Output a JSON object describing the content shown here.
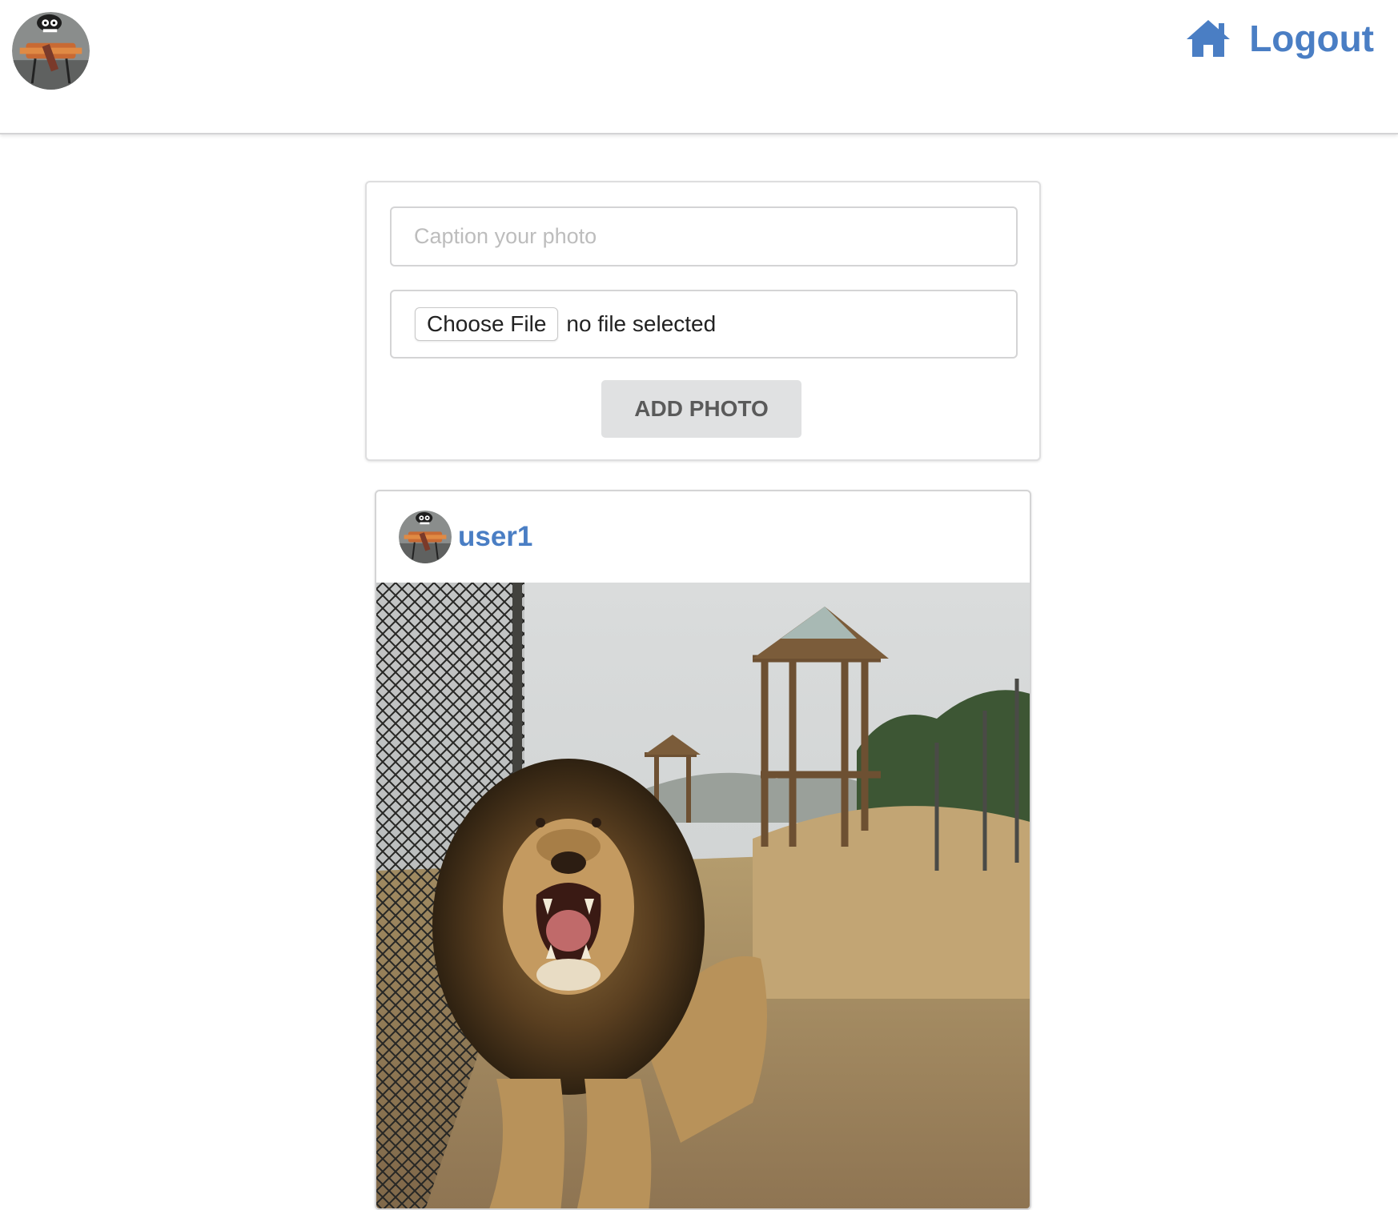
{
  "header": {
    "avatar_icon": "user-avatar-icon",
    "home_icon": "home-icon",
    "logout_label": "Logout",
    "accent_color": "#4a7ec4"
  },
  "upload_form": {
    "caption_placeholder": "Caption your photo",
    "caption_value": "",
    "choose_file_label": "Choose File",
    "file_status": "no file selected",
    "submit_label": "ADD PHOTO"
  },
  "feed": {
    "posts": [
      {
        "username": "user1",
        "avatar_icon": "user-avatar-icon",
        "photo_icon": "lion-photo"
      }
    ]
  }
}
